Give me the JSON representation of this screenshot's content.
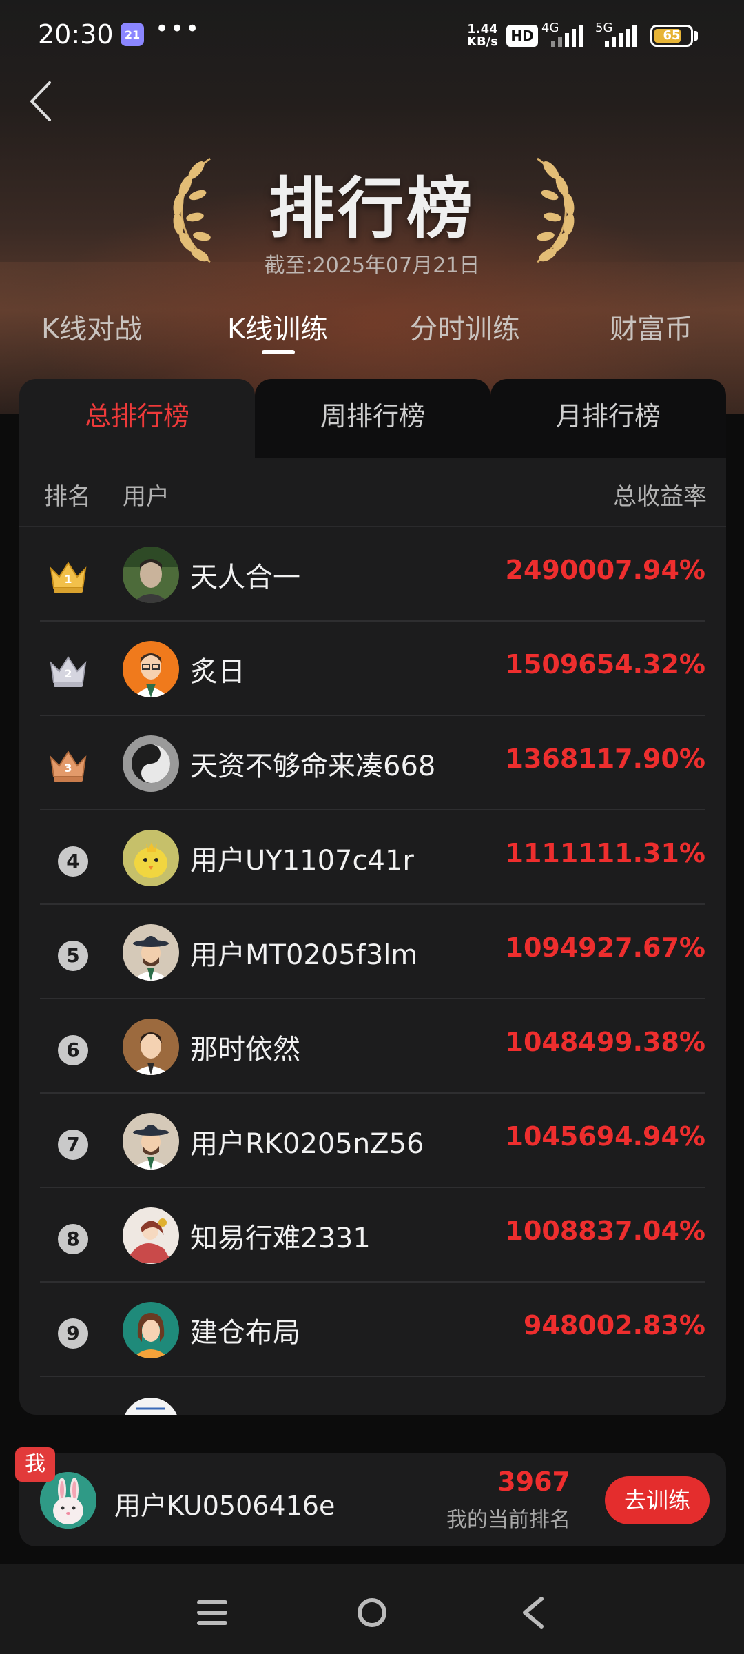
{
  "status_bar": {
    "time": "20:30",
    "calendar_day": "21",
    "more": "•••",
    "speed_value": "1.44",
    "speed_unit": "KB/s",
    "hd": "HD",
    "net1": "4G",
    "net2": "5G",
    "battery": "65"
  },
  "header": {
    "title": "排行榜",
    "date": "截至:2025年07月21日"
  },
  "tabs": [
    {
      "label": "K线对战"
    },
    {
      "label": "K线训练"
    },
    {
      "label": "分时训练"
    },
    {
      "label": "财富币"
    }
  ],
  "active_tab": "K线训练",
  "sub_tabs": [
    {
      "label": "总排行榜"
    },
    {
      "label": "周排行榜"
    },
    {
      "label": "月排行榜"
    }
  ],
  "table": {
    "col_rank": "排名",
    "col_user": "用户",
    "col_rate": "总收益率",
    "rows": [
      {
        "rank": "1",
        "name": "天人合一",
        "rate": "2490007.94%"
      },
      {
        "rank": "2",
        "name": "炙日",
        "rate": "1509654.32%"
      },
      {
        "rank": "3",
        "name": "天资不够命来凑668",
        "rate": "1368117.90%"
      },
      {
        "rank": "4",
        "name": "用户UY1107c41r",
        "rate": "1111111.31%"
      },
      {
        "rank": "5",
        "name": "用户MT0205f3lm",
        "rate": "1094927.67%"
      },
      {
        "rank": "6",
        "name": "那时依然",
        "rate": "1048499.38%"
      },
      {
        "rank": "7",
        "name": "用户RK0205nZ56",
        "rate": "1045694.94%"
      },
      {
        "rank": "8",
        "name": "知易行难2331",
        "rate": "1008837.04%"
      },
      {
        "rank": "9",
        "name": "建仓布局",
        "rate": "948002.83%"
      }
    ]
  },
  "me": {
    "badge": "我",
    "name": "用户KU0506416e",
    "rank": "3967",
    "rank_label": "我的当前排名",
    "button": "去训练"
  },
  "colors": {
    "accent_red": "#ee2e2e",
    "gold": "#e7b436",
    "silver": "#c8c8d0",
    "bronze": "#d38a5c"
  }
}
